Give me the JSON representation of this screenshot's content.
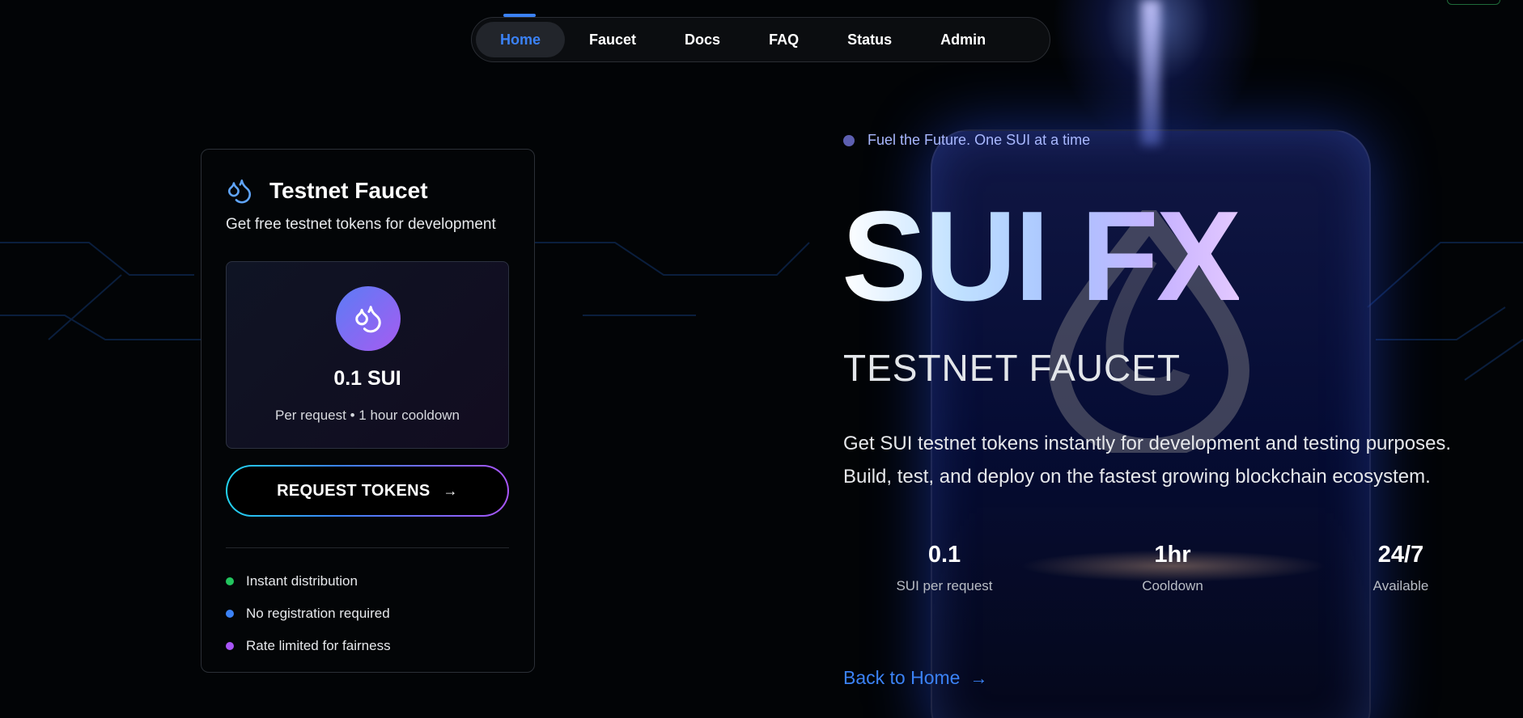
{
  "nav": {
    "items": [
      {
        "label": "Home",
        "active": true
      },
      {
        "label": "Faucet",
        "active": false
      },
      {
        "label": "Docs",
        "active": false
      },
      {
        "label": "FAQ",
        "active": false
      },
      {
        "label": "Status",
        "active": false
      },
      {
        "label": "Admin",
        "active": false
      }
    ]
  },
  "card": {
    "icon": "droplets-icon",
    "title": "Testnet Faucet",
    "subtitle": "Get free testnet tokens for development",
    "amount": "0.1 SUI",
    "amount_sub": "Per request • 1 hour cooldown",
    "button_label": "REQUEST TOKENS",
    "button_icon": "arrow-right-icon",
    "features": [
      {
        "label": "Instant distribution",
        "color": "#22c55e"
      },
      {
        "label": "No registration required",
        "color": "#3b82f6"
      },
      {
        "label": "Rate limited for fairness",
        "color": "#a855f7"
      }
    ]
  },
  "hero": {
    "tagline": "Fuel the Future. One SUI at a time",
    "title": "SUI FX",
    "subtitle": "TESTNET FAUCET",
    "description_line1": "Get SUI testnet tokens instantly for development and testing purposes.",
    "description_line2": "Build, test, and deploy on the fastest growing blockchain ecosystem.",
    "stats": [
      {
        "value": "0.1",
        "label": "SUI per request"
      },
      {
        "value": "1hr",
        "label": "Cooldown"
      },
      {
        "value": "24/7",
        "label": "Available"
      }
    ],
    "back_link": "Back to Home"
  },
  "colors": {
    "accent": "#3b82f6",
    "gradient_start": "#22d3ee",
    "gradient_end": "#a855f7"
  }
}
